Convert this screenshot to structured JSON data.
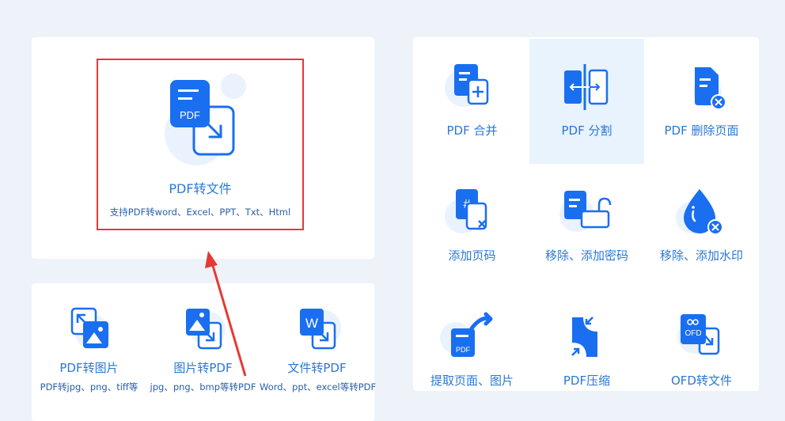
{
  "main": {
    "title": "PDF转文件",
    "subtitle": "支持PDF转word、Excel、PPT、Txt、Html",
    "icon_text": "PDF"
  },
  "convert": [
    {
      "label": "PDF转图片",
      "sub": "PDF转jpg、png、tiff等",
      "icon": "pdf-to-image-icon"
    },
    {
      "label": "图片转PDF",
      "sub": "jpg、png、bmp等转PDF",
      "icon": "image-to-pdf-icon"
    },
    {
      "label": "文件转PDF",
      "sub": "Word、ppt、excel等转PDF",
      "icon": "file-to-pdf-icon"
    }
  ],
  "tools": [
    {
      "label": "PDF 合并",
      "icon": "pdf-merge-icon"
    },
    {
      "label": "PDF 分割",
      "icon": "pdf-split-icon"
    },
    {
      "label": "PDF 删除页面",
      "icon": "pdf-delete-page-icon"
    },
    {
      "label": "添加页码",
      "icon": "add-page-number-icon"
    },
    {
      "label": "移除、添加密码",
      "icon": "password-icon"
    },
    {
      "label": "移除、添加水印",
      "icon": "watermark-icon"
    },
    {
      "label": "提取页面、图片",
      "icon": "extract-icon"
    },
    {
      "label": "PDF压缩",
      "icon": "compress-icon"
    },
    {
      "label": "OFD转文件",
      "icon": "ofd-convert-icon",
      "icon_text": "OFD"
    }
  ],
  "colors": {
    "primary": "#1a6ff0",
    "text": "#2a78d6",
    "highlight": "#e53935",
    "active_bg": "#e8f3fd"
  }
}
